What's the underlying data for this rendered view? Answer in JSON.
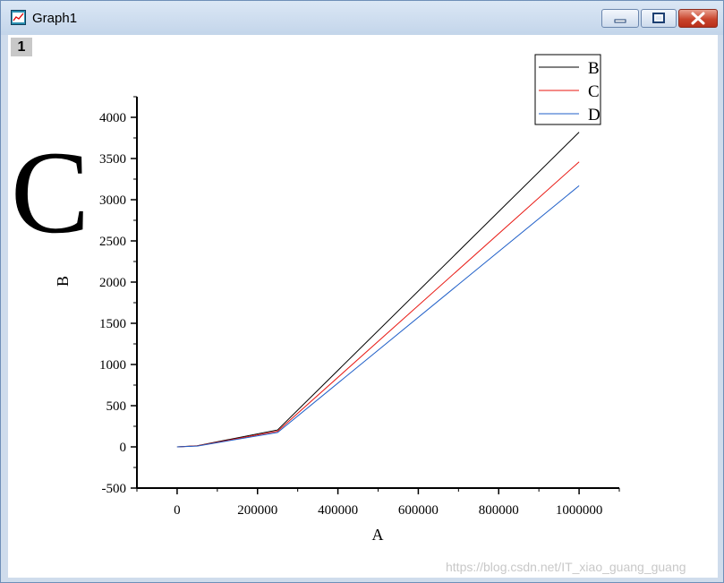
{
  "window": {
    "title": "Graph1",
    "layer_tab": "1",
    "watermark": "https://blog.csdn.net/IT_xiao_guang_guang"
  },
  "figure_letter": "C",
  "chart_data": {
    "type": "line",
    "xlabel": "A",
    "ylabel": "B",
    "xlim": [
      -100000,
      1100000
    ],
    "ylim": [
      -500,
      4250
    ],
    "x_ticks": [
      0,
      200000,
      400000,
      600000,
      800000,
      1000000
    ],
    "x_tick_labels": [
      "0",
      "200000",
      "400000",
      "600000",
      "800000",
      "1000000"
    ],
    "y_ticks": [
      -500,
      0,
      500,
      1000,
      1500,
      2000,
      2500,
      3000,
      3500,
      4000
    ],
    "y_tick_labels": [
      "-500",
      "0",
      "500",
      "1000",
      "1500",
      "2000",
      "2500",
      "3000",
      "3500",
      "4000"
    ],
    "legend_position": "top-right",
    "series": [
      {
        "name": "B",
        "color": "#000000",
        "x": [
          0,
          50000,
          250000,
          1000000
        ],
        "y": [
          0,
          14,
          205,
          3820
        ]
      },
      {
        "name": "C",
        "color": "#e8150f",
        "x": [
          0,
          50000,
          250000,
          1000000
        ],
        "y": [
          0,
          12,
          190,
          3460
        ]
      },
      {
        "name": "D",
        "color": "#1f5fc8",
        "x": [
          0,
          50000,
          250000,
          1000000
        ],
        "y": [
          0,
          10,
          175,
          3170
        ]
      }
    ]
  }
}
